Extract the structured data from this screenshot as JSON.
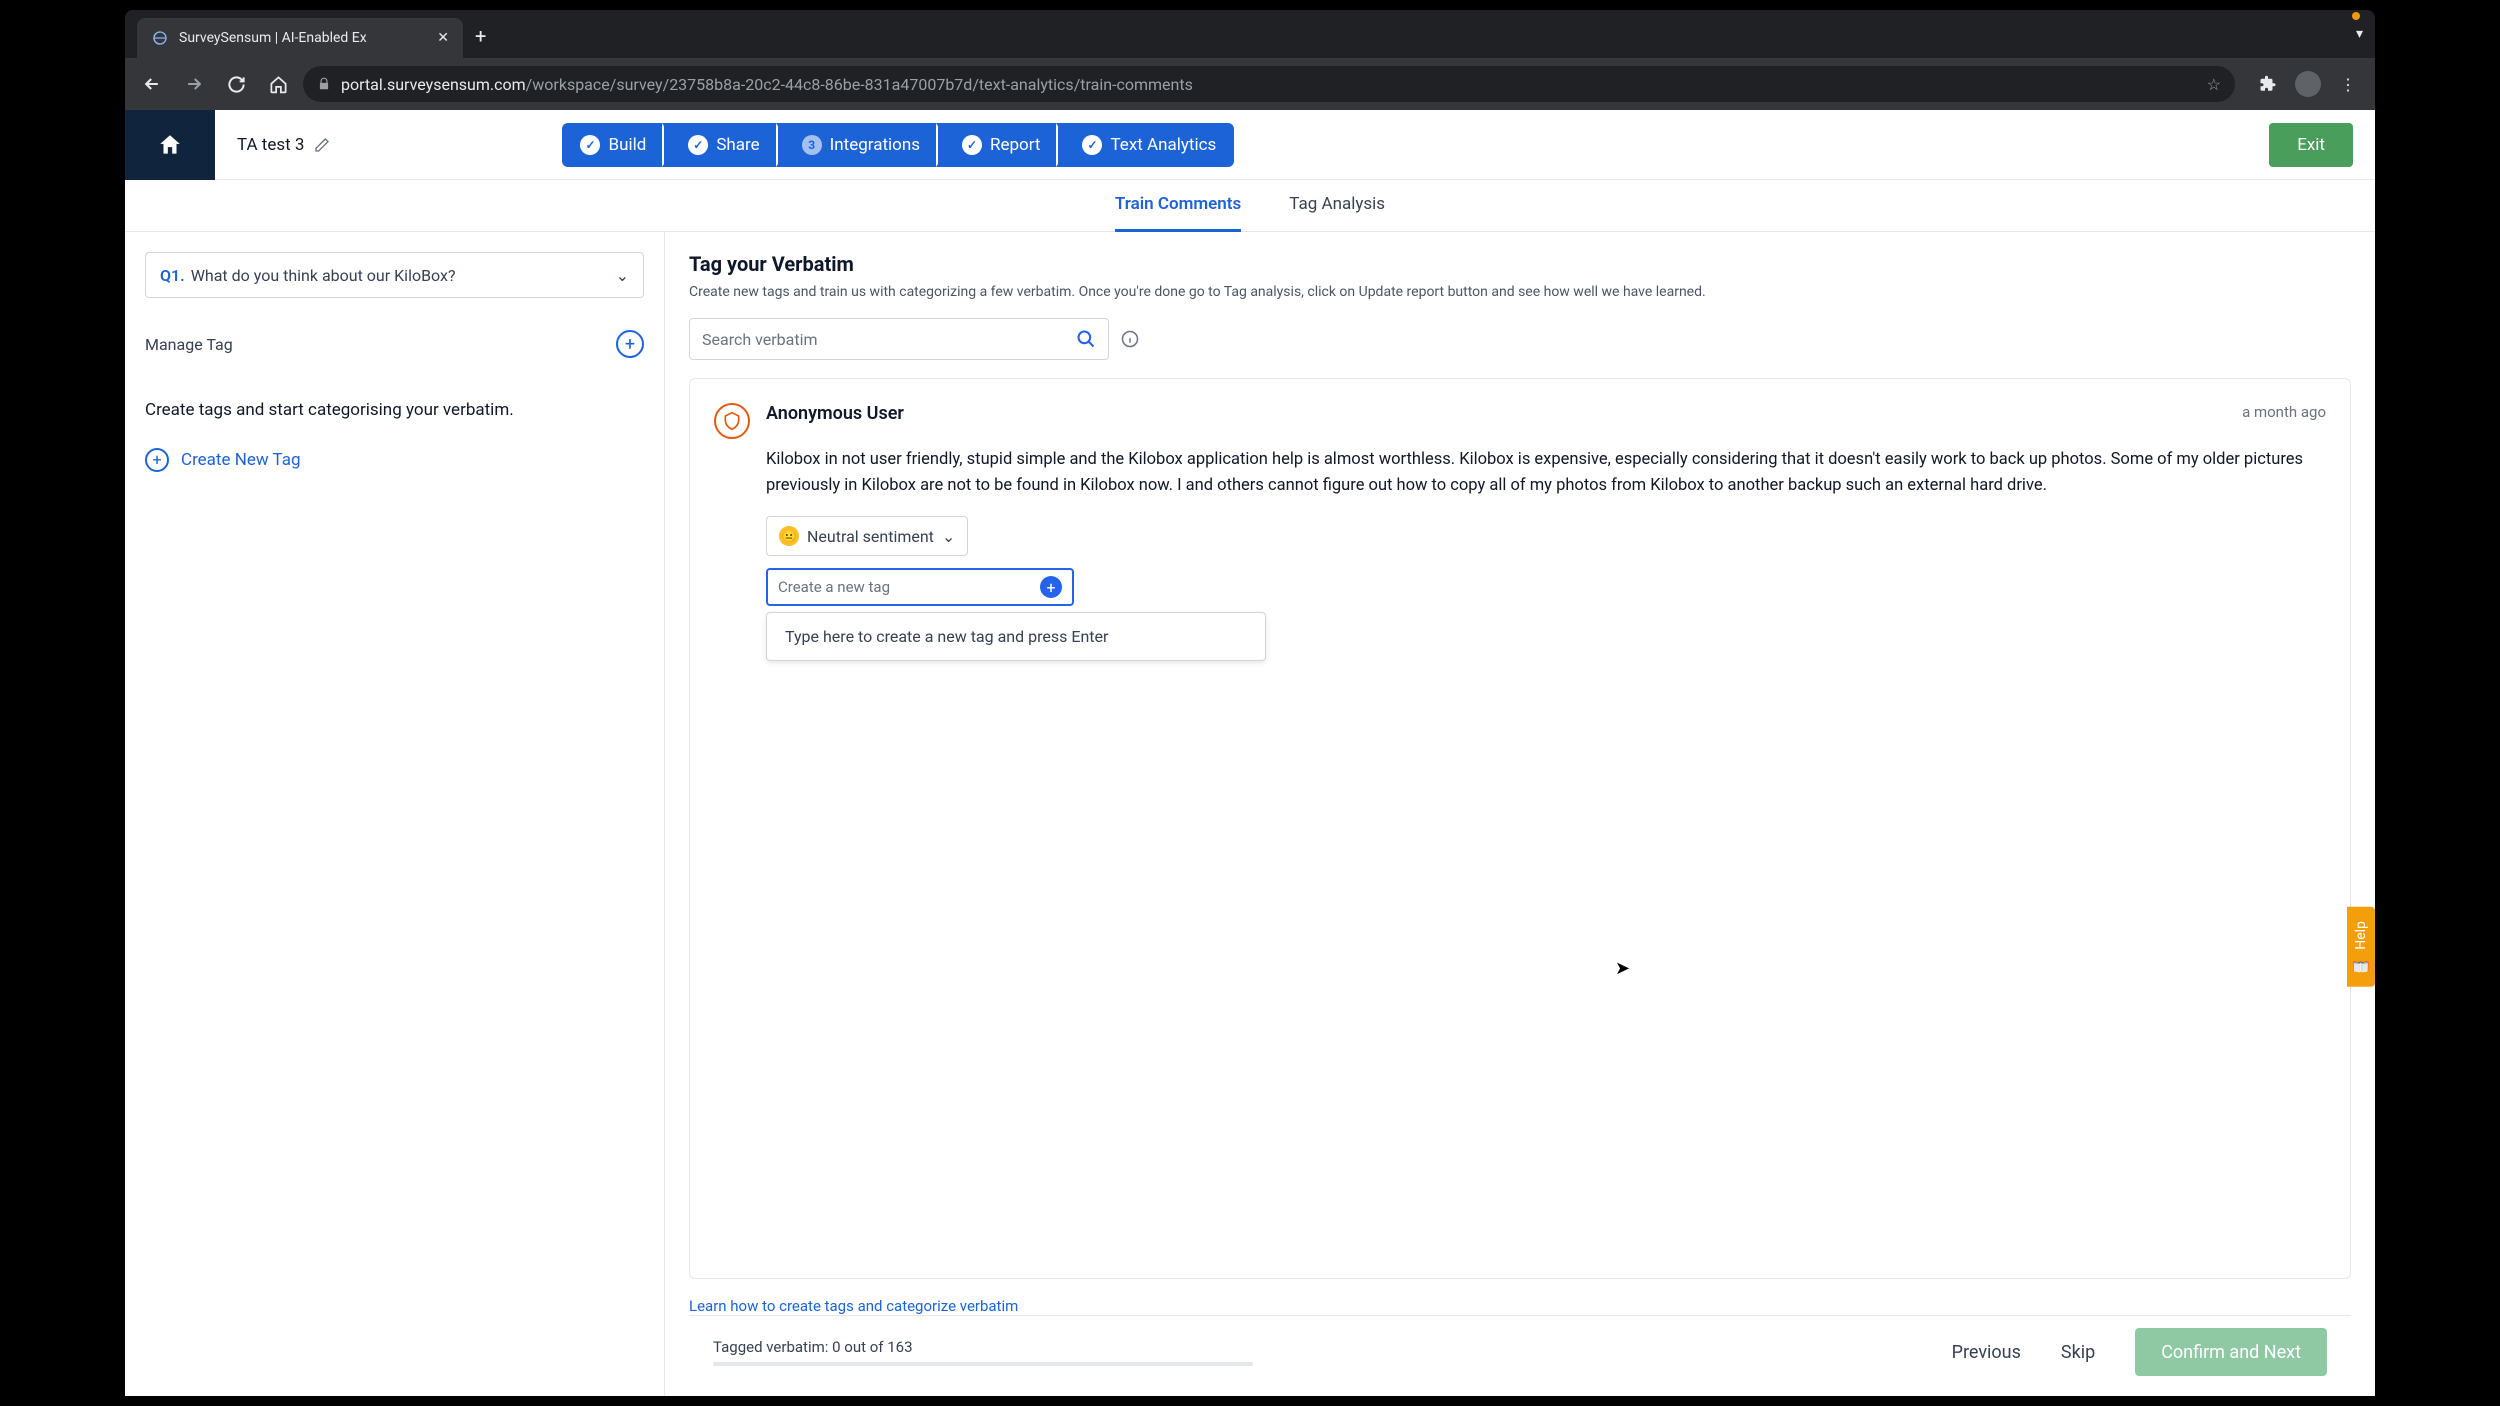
{
  "browser": {
    "tab_title": "SurveySensum | AI-Enabled Ex",
    "url_display_prefix": "portal.surveysensum.com",
    "url_display_rest": "/workspace/survey/23758b8a-20c2-44c8-86be-831a47007b7d/text-analytics/train-comments"
  },
  "appbar": {
    "title": "TA test 3",
    "steps": [
      {
        "label": "Build",
        "done": true
      },
      {
        "label": "Share",
        "done": true
      },
      {
        "label": "Integrations",
        "done": false,
        "num": "3"
      },
      {
        "label": "Report",
        "done": true
      },
      {
        "label": "Text Analytics",
        "done": true
      }
    ],
    "exit": "Exit"
  },
  "subtabs": {
    "train": "Train Comments",
    "analysis": "Tag Analysis"
  },
  "sidebar": {
    "question_prefix": "Q1.",
    "question_text": "What do you think about our KiloBox?",
    "manage_tag": "Manage Tag",
    "desc": "Create tags and start categorising your verbatim.",
    "create_new_tag": "Create New Tag"
  },
  "content": {
    "heading": "Tag your Verbatim",
    "desc": "Create new tags and train us with categorizing a few verbatim. Once you're done go to Tag analysis, click on Update report button and see how well we have learned.",
    "search_placeholder": "Search verbatim",
    "card": {
      "user": "Anonymous User",
      "time": "a month ago",
      "body": "Kilobox in not user friendly, stupid simple and the Kilobox application help is almost worthless. Kilobox is expensive, especially considering that it doesn't easily work to back up photos. Some of my older pictures previously in Kilobox are not to be found in Kilobox now. I and others cannot figure out how to copy all of my photos from Kilobox to another backup such an external hard drive.",
      "sentiment": "Neutral sentiment",
      "create_tag_placeholder": "Create a new tag",
      "dropdown_hint": "Type here to create a new tag and press Enter"
    },
    "learn_link": "Learn how to create tags and categorize verbatim"
  },
  "footer": {
    "status": "Tagged verbatim: 0 out of 163",
    "previous": "Previous",
    "skip": "Skip",
    "confirm": "Confirm and Next"
  },
  "help": "Help"
}
